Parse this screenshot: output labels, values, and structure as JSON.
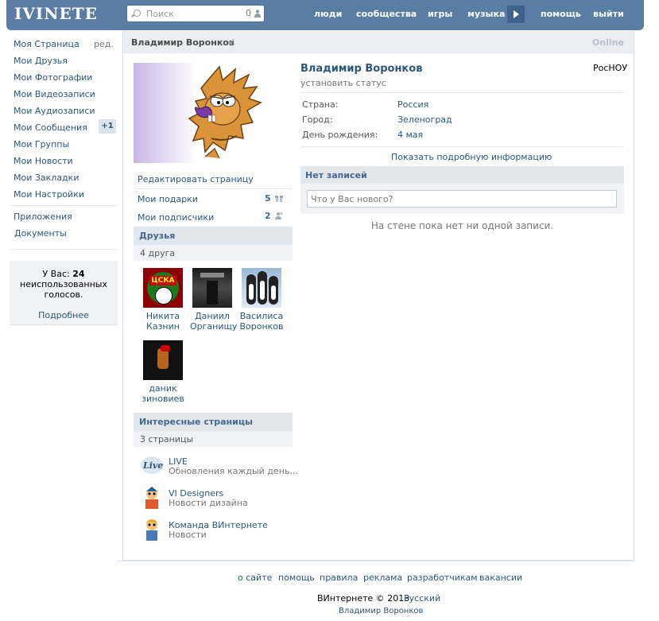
{
  "header": {
    "logo": "IVINETE",
    "search_placeholder": "Поиск",
    "search_count": "0",
    "nav": [
      "люди",
      "сообщества",
      "игры",
      "музыка",
      "помощь",
      "выйти"
    ]
  },
  "sidebar": {
    "items": [
      {
        "label": "Моя Страница"
      },
      {
        "label": "Мои Друзья"
      },
      {
        "label": "Мои Фотографии"
      },
      {
        "label": "Мои Видеозаписи"
      },
      {
        "label": "Мои Аудиозаписи"
      },
      {
        "label": "Мои Сообщения"
      },
      {
        "label": "Мои Группы"
      },
      {
        "label": "Мои Новости"
      },
      {
        "label": "Мои Закладки"
      },
      {
        "label": "Мои Настройки"
      }
    ],
    "edit_label": "ред.",
    "messages_badge": "+1",
    "extra": [
      "Приложения",
      "Документы"
    ],
    "votes": {
      "prefix": "У Вас:",
      "count": "24",
      "line2": "неиспользованных",
      "line3": "голосов.",
      "more": "Подробнее"
    }
  },
  "profile": {
    "title_name": "Владимир Воронков",
    "online": "Online",
    "name": "Владимир Воронков",
    "status_placeholder": "установить статус",
    "university": "РосНОУ",
    "info": [
      {
        "label": "Страна:",
        "value": "Россия"
      },
      {
        "label": "Город:",
        "value": "Зеленоград"
      },
      {
        "label": "День рождения:",
        "value": "4 мая"
      }
    ],
    "more_info": "Показать подробную информацию",
    "edit_page": "Редактировать страницу",
    "gifts": {
      "label": "Мои подарки",
      "count": "5"
    },
    "followers": {
      "label": "Мои подписчики",
      "count": "2"
    }
  },
  "friends": {
    "title": "Друзья",
    "count": "4 друга",
    "items": [
      {
        "first": "Никита",
        "last": "Казнин"
      },
      {
        "first": "Даниил",
        "last": "Органищу"
      },
      {
        "first": "Василиса",
        "last": "Воронков"
      },
      {
        "first": "даник",
        "last": "зиновиев"
      }
    ]
  },
  "pages": {
    "title": "Интересные страницы",
    "count": "3 страницы",
    "items": [
      {
        "title": "LIVE",
        "desc": "Обновления каждый день...",
        "icon": "live-logo-icon"
      },
      {
        "title": "VI Designers",
        "desc": "Новости дизайна",
        "icon": "designer-avatar-icon"
      },
      {
        "title": "Команда ВИнтернете",
        "desc": "Новости",
        "icon": "team-avatar-icon"
      }
    ]
  },
  "wall": {
    "title": "Нет записей",
    "placeholder": "Что у Вас нового?",
    "empty": "На стене пока нет ни одной записи."
  },
  "footer": {
    "links": [
      "о сайте",
      "помощь",
      "правила",
      "реклама",
      "разработчикам",
      "вакансии"
    ],
    "copyright": "ВИнтернете © 2013",
    "language": "Русский",
    "author": "Владимир Воронков"
  },
  "colors": {
    "header": "#597DA3",
    "link": "#2B587A",
    "block_header": "#E1E7ED"
  }
}
